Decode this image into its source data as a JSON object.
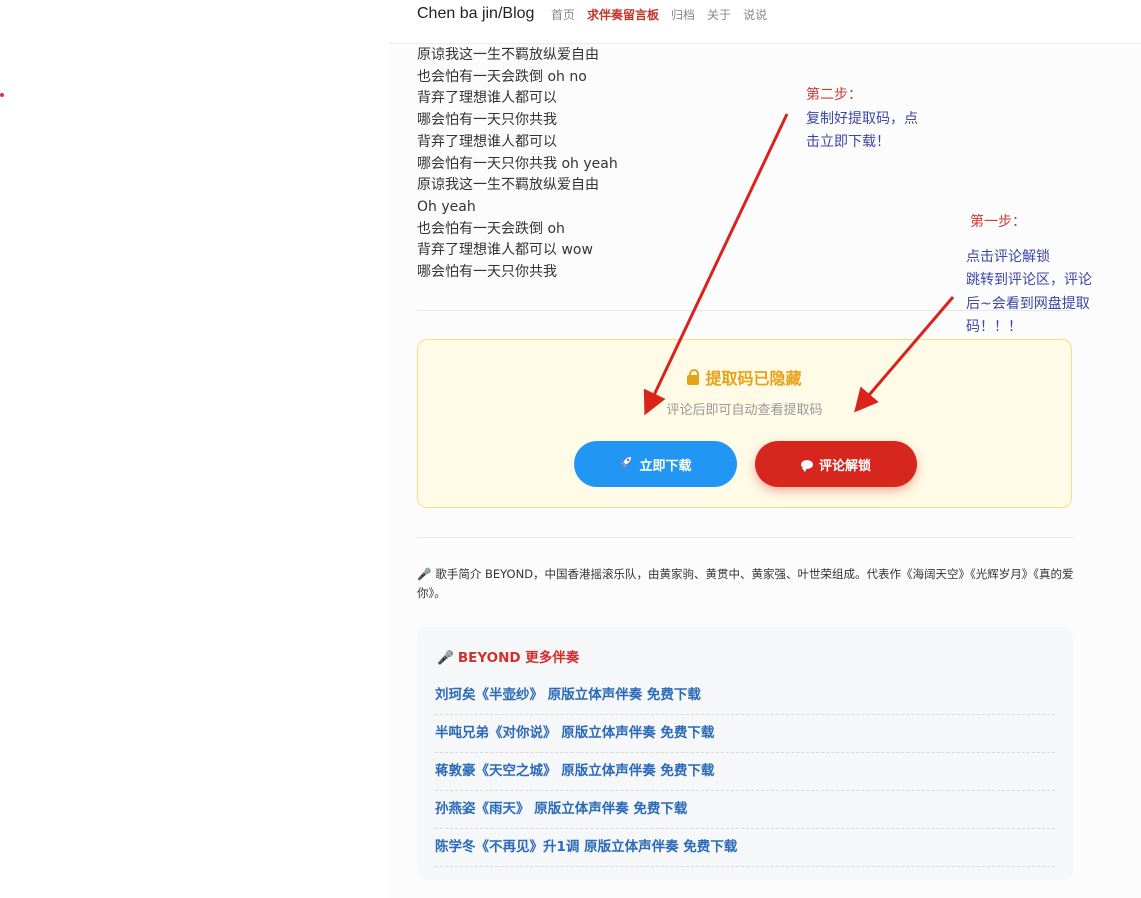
{
  "header": {
    "brand": "Chen ba jin/Blog",
    "nav": [
      "首页",
      "求伴奏留言板",
      "归档",
      "关于",
      "说说"
    ],
    "active_nav": "求伴奏留言板"
  },
  "lyrics": [
    "原谅我这一生不羁放纵爱自由",
    "也会怕有一天会跌倒 oh no",
    "背弃了理想谁人都可以",
    "哪会怕有一天只你共我",
    "背弃了理想谁人都可以",
    "哪会怕有一天只你共我 oh yeah",
    "原谅我这一生不羁放纵爱自由",
    "Oh yeah",
    "也会怕有一天会跌倒 oh",
    "背弃了理想谁人都可以 wow",
    "哪会怕有一天只你共我"
  ],
  "download_box": {
    "title": "提取码已隐藏",
    "hint": "评论后即可自动查看提取码",
    "download_label": "立即下载",
    "comment_label": "评论解锁",
    "download_icon": "rocket-icon",
    "comment_icon": "comment-icon"
  },
  "intro": {
    "icon": "🎤",
    "text": "歌手简介 BEYOND，中国香港摇滚乐队，由黄家驹、黄贯中、黄家强、叶世荣组成。代表作《海阔天空》《光辉岁月》《真的爱你》。"
  },
  "more": {
    "title": "BEYOND 更多伴奏",
    "icon": "🎤",
    "links": [
      "刘珂矣《半壶纱》 原版立体声伴奏 免费下载",
      "半吨兄弟《对你说》 原版立体声伴奏 免费下载",
      "蒋敦豪《天空之城》 原版立体声伴奏 免费下载",
      "孙燕姿《雨天》 原版立体声伴奏 免费下载",
      "陈学冬《不再见》升1调 原版立体声伴奏 免费下载"
    ]
  },
  "annotations": {
    "step2": {
      "head": "第二步：",
      "lines": [
        "复制好提取码，点",
        "击立即下载！"
      ]
    },
    "step1": {
      "head": "第一步：",
      "lines": [
        "点击评论解锁",
        "跳转到评论区，评论",
        "后~会看到网盘提取",
        "码！！！"
      ]
    }
  },
  "colors": {
    "accent_red": "#d7261e",
    "accent_blue": "#2196f3",
    "hidden_title": "#e8a21a",
    "link": "#2b6ab8",
    "arrow": "#d9231d"
  }
}
